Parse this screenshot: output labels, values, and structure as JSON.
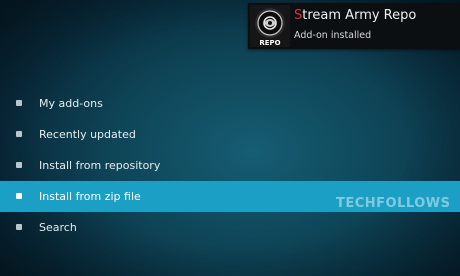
{
  "notification": {
    "title_first": "S",
    "title_rest": "tream Army Repo",
    "subtitle": "Add-on installed",
    "logo_text": "REPO",
    "logo_icon": "addon-logo-icon"
  },
  "menu": {
    "items": [
      {
        "label": "My add-ons",
        "icon": "bullet-icon"
      },
      {
        "label": "Recently updated",
        "icon": "bullet-icon"
      },
      {
        "label": "Install from repository",
        "icon": "bullet-icon"
      },
      {
        "label": "Install from zip file",
        "icon": "bullet-icon",
        "selected": true
      },
      {
        "label": "Search",
        "icon": "bullet-icon"
      }
    ]
  },
  "watermark": "TECHFOLLOWS",
  "colors": {
    "background": "#0e4456",
    "highlight": "#1b9fc4",
    "title_accent": "#e0303a"
  }
}
